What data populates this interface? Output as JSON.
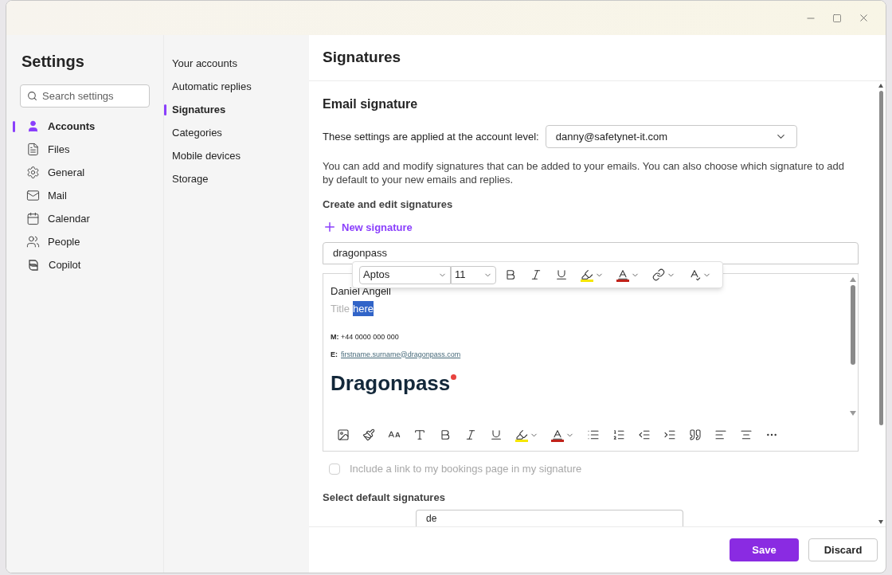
{
  "settings": {
    "title": "Settings",
    "search": {
      "placeholder": "Search settings"
    },
    "categories": [
      {
        "label": "Accounts",
        "selected": true
      },
      {
        "label": "Files",
        "selected": false
      },
      {
        "label": "General",
        "selected": false
      },
      {
        "label": "Mail",
        "selected": false
      },
      {
        "label": "Calendar",
        "selected": false
      },
      {
        "label": "People",
        "selected": false
      },
      {
        "label": "Copilot",
        "selected": false
      }
    ]
  },
  "subnav": [
    {
      "label": "Your accounts",
      "selected": false
    },
    {
      "label": "Automatic replies",
      "selected": false
    },
    {
      "label": "Signatures",
      "selected": true
    },
    {
      "label": "Categories",
      "selected": false
    },
    {
      "label": "Mobile devices",
      "selected": false
    },
    {
      "label": "Storage",
      "selected": false
    }
  ],
  "page": {
    "title": "Signatures",
    "section_title": "Email signature",
    "account_label": "These settings are applied at the account level:",
    "account_value": "danny@safetynet-it.com",
    "description": "You can add and modify signatures that can be added to your emails. You can also choose which signature to add by default to your new emails and replies.",
    "create_heading": "Create and edit signatures",
    "new_signature": "New signature",
    "signature_name": "dragonpass",
    "float_toolbar": {
      "font": "Aptos",
      "size": "11"
    },
    "editor": {
      "name": "Daniel Angell",
      "title_placeholder": "Title",
      "title_selected": "here",
      "phone": "**M:** +44 0000 000 000",
      "email_label": "E:",
      "email": "firstname.surname@dragonpass.com",
      "logo": "Dragonpass"
    },
    "include_bookings": {
      "label": "Include a link to my bookings page in my signature",
      "checked": false,
      "disabled": true
    },
    "default_heading": "Select default signatures",
    "default_value": "de"
  },
  "footer": {
    "save": "Save",
    "discard": "Discard"
  }
}
